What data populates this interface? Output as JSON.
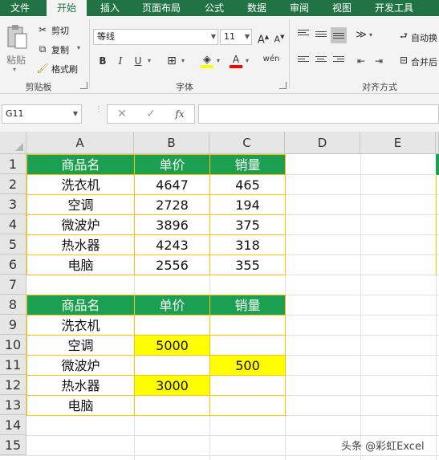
{
  "ribbon": {
    "tabs": [
      "文件",
      "开始",
      "插入",
      "页面布局",
      "公式",
      "数据",
      "审阅",
      "视图",
      "开发工具"
    ],
    "active_tab": "开始",
    "clipboard": {
      "paste_label": "粘贴",
      "cut_label": "剪切",
      "copy_label": "复制",
      "format_painter_label": "格式刷",
      "group_label": "剪贴板"
    },
    "font": {
      "font_name": "等线",
      "font_size": "11",
      "grow_label": "A",
      "shrink_label": "A",
      "bold": "B",
      "italic": "I",
      "underline": "U",
      "font_color_label": "A",
      "phonetic_label": "wén",
      "group_label": "字体"
    },
    "alignment": {
      "wrap_text_label": "自动换",
      "merge_label": "合并后",
      "group_label": "对齐方式"
    }
  },
  "formula_bar": {
    "name_box": "G11",
    "cancel_icon": "✕",
    "enter_icon": "✓",
    "fx_label": "fx",
    "formula": ""
  },
  "sheet": {
    "columns": [
      "A",
      "B",
      "C",
      "D",
      "E"
    ],
    "rows": [
      "1",
      "2",
      "3",
      "4",
      "5",
      "6",
      "7",
      "8",
      "9",
      "10",
      "11",
      "12",
      "13",
      "14",
      "15"
    ],
    "table1": {
      "headers": [
        "商品名",
        "单价",
        "销量"
      ],
      "rows": [
        [
          "洗衣机",
          "4647",
          "465"
        ],
        [
          "空调",
          "2728",
          "194"
        ],
        [
          "微波炉",
          "3896",
          "375"
        ],
        [
          "热水器",
          "4243",
          "318"
        ],
        [
          "电脑",
          "2556",
          "355"
        ]
      ]
    },
    "table2": {
      "headers": [
        "商品名",
        "单价",
        "销量"
      ],
      "rows": [
        [
          "洗衣机",
          "",
          ""
        ],
        [
          "空调",
          "5000",
          ""
        ],
        [
          "微波炉",
          "",
          "500"
        ],
        [
          "热水器",
          "3000",
          ""
        ],
        [
          "电脑",
          "",
          ""
        ]
      ]
    }
  },
  "colors": {
    "header_green": "#1aa050",
    "border_gold": "#ffc000",
    "highlight_yellow": "#ffff00",
    "ribbon_green": "#217346"
  },
  "watermark": "头条 @彩虹Excel"
}
